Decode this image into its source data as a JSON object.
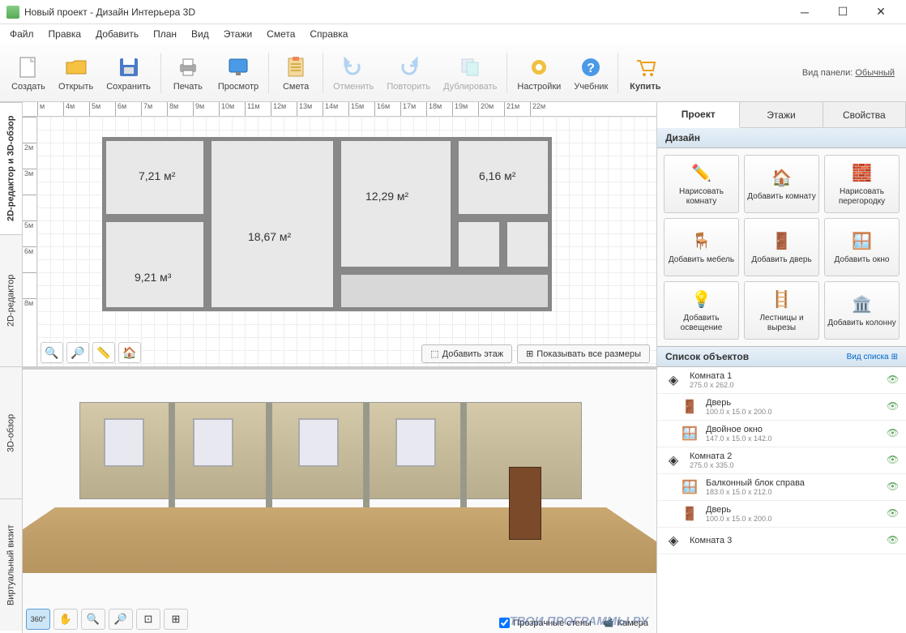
{
  "window": {
    "title": "Новый проект - Дизайн Интерьера 3D"
  },
  "menu": [
    "Файл",
    "Правка",
    "Добавить",
    "План",
    "Вид",
    "Этажи",
    "Смета",
    "Справка"
  ],
  "toolbar": {
    "create": "Создать",
    "open": "Открыть",
    "save": "Сохранить",
    "print": "Печать",
    "preview": "Просмотр",
    "estimate": "Смета",
    "undo": "Отменить",
    "redo": "Повторить",
    "duplicate": "Дублировать",
    "settings": "Настройки",
    "tutorial": "Учебник",
    "buy": "Купить",
    "panel_label": "Вид панели:",
    "panel_mode": "Обычный"
  },
  "vtabs": [
    "2D-редактор и 3D-обзор",
    "2D-редактор",
    "3D-обзор",
    "Виртуальный визит"
  ],
  "ruler_h": [
    "м",
    "4м",
    "5м",
    "6м",
    "7м",
    "8м",
    "9м",
    "10м",
    "11м",
    "12м",
    "13м",
    "14м",
    "15м",
    "16м",
    "17м",
    "18м",
    "19м",
    "20м",
    "21м",
    "22м"
  ],
  "ruler_v": [
    "",
    "2м",
    "3м",
    "",
    "5м",
    "6м",
    "",
    "8м"
  ],
  "rooms": {
    "r1": "7,21 м²",
    "r2": "18,67 м²",
    "r3": "12,29 м²",
    "r4": "6,16 м²",
    "r5": "9,21 м³"
  },
  "plan_actions": {
    "add_floor": "Добавить этаж",
    "show_dims": "Показывать все размеры"
  },
  "view3d": {
    "transparent": "Прозрачные стены",
    "camera": "Камера"
  },
  "side_tabs": [
    "Проект",
    "Этажи",
    "Свойства"
  ],
  "design_header": "Дизайн",
  "design_buttons": [
    {
      "label": "Нарисовать комнату",
      "icon": "pencil"
    },
    {
      "label": "Добавить комнату",
      "icon": "plus-room"
    },
    {
      "label": "Нарисовать перегородку",
      "icon": "wall"
    },
    {
      "label": "Добавить мебель",
      "icon": "chair"
    },
    {
      "label": "Добавить дверь",
      "icon": "door"
    },
    {
      "label": "Добавить окно",
      "icon": "window"
    },
    {
      "label": "Добавить освещение",
      "icon": "bulb"
    },
    {
      "label": "Лестницы и вырезы",
      "icon": "stairs"
    },
    {
      "label": "Добавить колонну",
      "icon": "column"
    }
  ],
  "objects_header": "Список объектов",
  "view_list": "Вид списка",
  "objects": [
    {
      "name": "Комната 1",
      "dims": "275.0 x 262.0",
      "type": "room",
      "level": 0
    },
    {
      "name": "Дверь",
      "dims": "100.0 x 15.0 x 200.0",
      "type": "door",
      "level": 1
    },
    {
      "name": "Двойное окно",
      "dims": "147.0 x 15.0 x 142.0",
      "type": "window",
      "level": 1
    },
    {
      "name": "Комната 2",
      "dims": "275.0 x 335.0",
      "type": "room",
      "level": 0
    },
    {
      "name": "Балконный блок справа",
      "dims": "183.0 x 15.0 x 212.0",
      "type": "window",
      "level": 1
    },
    {
      "name": "Дверь",
      "dims": "100.0 x 15.0 x 200.0",
      "type": "door",
      "level": 1
    },
    {
      "name": "Комната 3",
      "dims": "",
      "type": "room",
      "level": 0
    }
  ],
  "watermark": "ТВОИ ПРОГРАММЫ РУ"
}
